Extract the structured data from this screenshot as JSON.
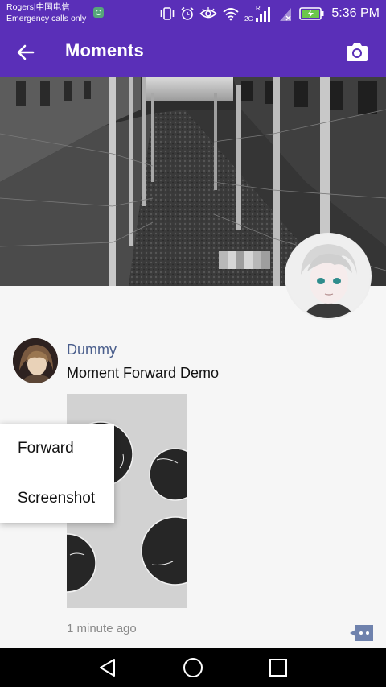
{
  "status_bar": {
    "carrier_line1": "Rogers|中国电信",
    "carrier_line2": "Emergency calls only",
    "network_label": "2G",
    "roaming_label": "R",
    "time": "5:36 PM",
    "icons": [
      "app-notification-icon",
      "vibrate-icon",
      "alarm-icon",
      "eye-icon",
      "wifi-icon",
      "signal-icon",
      "no-signal-icon",
      "battery-charging-icon"
    ]
  },
  "app_bar": {
    "title": "Moments",
    "back_icon": "arrow-left-icon",
    "camera_icon": "camera-icon"
  },
  "post": {
    "author": "Dummy",
    "text": "Moment Forward Demo",
    "time": "1 minute ago",
    "comment_icon": "comment-icon"
  },
  "popup_menu": {
    "items": [
      {
        "label": "Forward"
      },
      {
        "label": "Screenshot"
      }
    ]
  },
  "nav_bar": {
    "icons": [
      "back-triangle-icon",
      "home-circle-icon",
      "recents-square-icon"
    ]
  },
  "colors": {
    "primary": "#5a2fb8",
    "author_name": "#4a5e8c",
    "timestamp": "#8a8a8a",
    "background": "#f6f6f6"
  }
}
